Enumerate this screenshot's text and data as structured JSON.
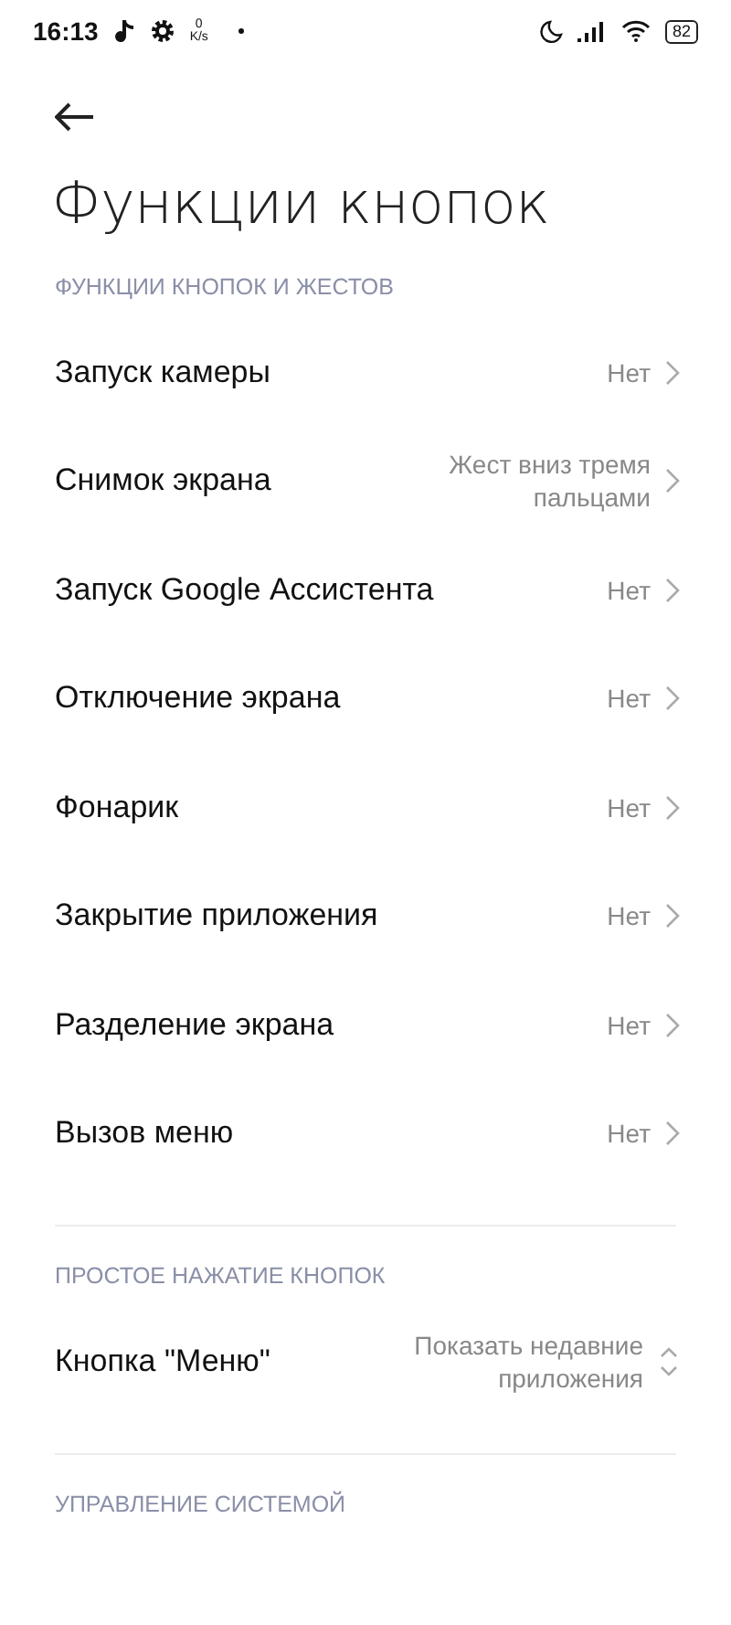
{
  "status_bar": {
    "time": "16:13",
    "speed_value": "0",
    "speed_unit": "K/s",
    "battery": "82"
  },
  "title": "Функции кнопок",
  "sections": [
    {
      "header": "ФУНКЦИИ КНОПОК И ЖЕСТОВ",
      "rows": [
        {
          "kind": "link",
          "label": "Запуск камеры",
          "value": "Нет"
        },
        {
          "kind": "link",
          "label": "Снимок экрана",
          "value": "Жест вниз тремя пальцами"
        },
        {
          "kind": "link",
          "label": "Запуск Google Ассистента",
          "value": "Нет"
        },
        {
          "kind": "link",
          "label": "Отключение экрана",
          "value": "Нет"
        },
        {
          "kind": "link",
          "label": "Фонарик",
          "value": "Нет"
        },
        {
          "kind": "link",
          "label": "Закрытие приложения",
          "value": "Нет"
        },
        {
          "kind": "link",
          "label": "Разделение экрана",
          "value": "Нет"
        },
        {
          "kind": "link",
          "label": "Вызов меню",
          "value": "Нет"
        }
      ]
    },
    {
      "header": "ПРОСТОЕ НАЖАТИЕ КНОПОК",
      "rows": [
        {
          "kind": "select",
          "label": "Кнопка \"Меню\"",
          "value": "Показать недавние приложения"
        }
      ]
    },
    {
      "header": "УПРАВЛЕНИЕ СИСТЕМОЙ"
    }
  ]
}
